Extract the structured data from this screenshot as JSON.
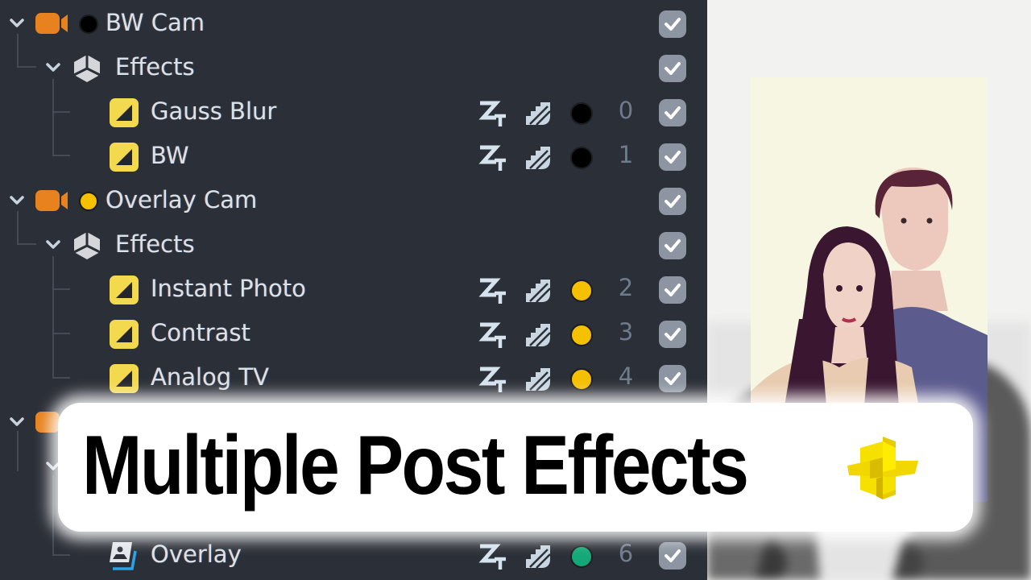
{
  "tree": {
    "rows": [
      {
        "type": "camera",
        "label": "BW Cam",
        "tag_color": "#000000",
        "expanded": true,
        "enabled": true
      },
      {
        "type": "group",
        "label": "Effects",
        "expanded": true,
        "enabled": true
      },
      {
        "type": "effect",
        "label": "Gauss Blur",
        "tag_color": "#000000",
        "order": "0",
        "enabled": true
      },
      {
        "type": "effect",
        "label": "BW",
        "tag_color": "#000000",
        "order": "1",
        "enabled": true
      },
      {
        "type": "camera",
        "label": "Overlay Cam",
        "tag_color": "#f5c000",
        "expanded": true,
        "enabled": true
      },
      {
        "type": "group",
        "label": "Effects",
        "expanded": true,
        "enabled": true
      },
      {
        "type": "effect",
        "label": "Instant Photo",
        "tag_color": "#f5c000",
        "order": "2",
        "enabled": true
      },
      {
        "type": "effect",
        "label": "Contrast",
        "tag_color": "#f5c000",
        "order": "3",
        "enabled": true
      },
      {
        "type": "effect",
        "label": "Analog TV",
        "tag_color": "#f5c000",
        "order": "4",
        "enabled": true
      },
      {
        "type": "overlay",
        "label": "Overlay",
        "tag_color": "#14a878",
        "order": "6",
        "enabled": true
      }
    ]
  },
  "colors": {
    "panel_bg": "#2b2f37",
    "camera_icon": "#e8821e",
    "effect_icon": "#f2d94e",
    "checkbox": "#8c95a1",
    "overlay_accent": "#2aa4e8"
  },
  "banner": {
    "title": "Multiple Post Effects",
    "logo": "yellow-cube-logo"
  },
  "preview": {
    "description": "Preview with instant-photo effect over black-and-white background"
  }
}
